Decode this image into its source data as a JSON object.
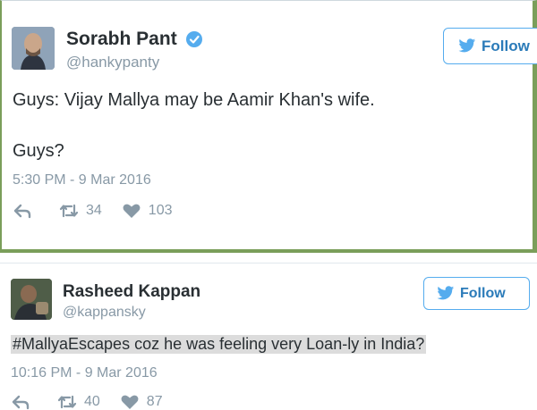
{
  "tweets": [
    {
      "display_name": "Sorabh Pant",
      "handle": "@hankypanty",
      "verified": true,
      "follow_label": "Follow",
      "text_lines": [
        "Guys: Vijay Mallya may be Aamir Khan's wife.",
        "Guys?"
      ],
      "timestamp": "5:30 PM - 9 Mar 2016",
      "retweets": "34",
      "likes": "103"
    },
    {
      "display_name": "Rasheed Kappan",
      "handle": "@kappansky",
      "verified": false,
      "follow_label": "Follow",
      "text": "#MallyaEscapes coz he was feeling very Loan-ly in India?",
      "timestamp": "10:16 PM - 9 Mar 2016",
      "retweets": "40",
      "likes": "87"
    }
  ],
  "colors": {
    "accent": "#55acee",
    "follow_text": "#2b7bb9",
    "card_border": "#7a9e5a",
    "muted": "#8899a6",
    "text": "#292f33"
  },
  "icons": [
    "verified-badge-icon",
    "twitter-bird-icon",
    "reply-icon",
    "retweet-icon",
    "heart-icon"
  ]
}
